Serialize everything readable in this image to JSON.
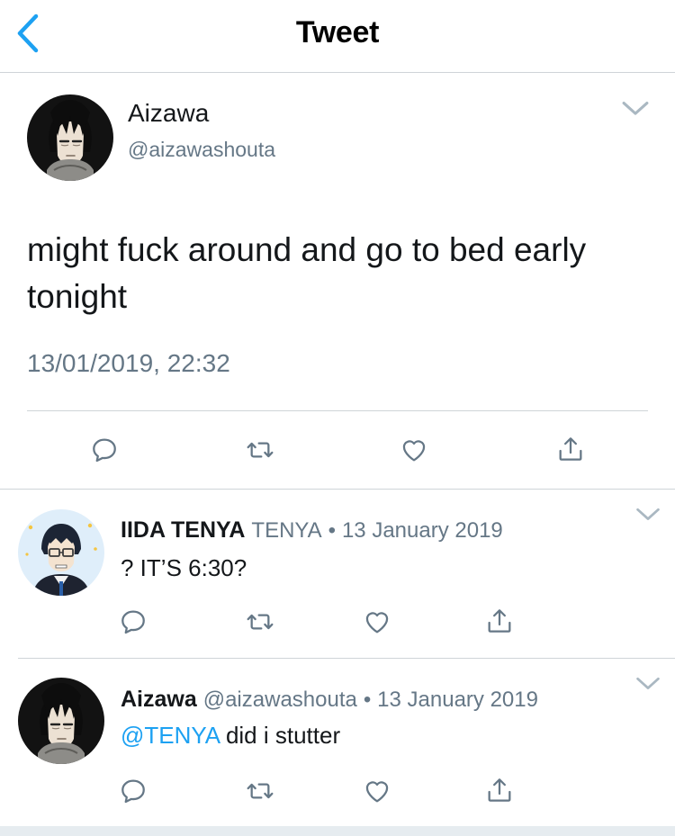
{
  "header": {
    "title": "Tweet",
    "back_icon": "chevron-left-icon"
  },
  "colors": {
    "accent": "#1da1f2",
    "text": "#14171a",
    "secondary": "#657786",
    "divider": "#cfd4d8"
  },
  "main_tweet": {
    "display_name": "Aizawa",
    "handle": "@aizawashouta",
    "text": "might fuck around and go to bed early tonight",
    "timestamp": "13/01/2019, 22:32",
    "actions": [
      "reply-icon",
      "retweet-icon",
      "like-icon",
      "share-icon"
    ]
  },
  "replies": [
    {
      "display_name": "IIDA TENYA",
      "handle": "TENYA",
      "separator": "•",
      "date": "13 January 2019",
      "text": "? IT’S 6:30?"
    },
    {
      "display_name": "Aizawa",
      "handle": "@aizawashouta",
      "separator": "•",
      "date": "13 January 2019",
      "mention": "@TENYA",
      "text": " did i stutter"
    }
  ]
}
